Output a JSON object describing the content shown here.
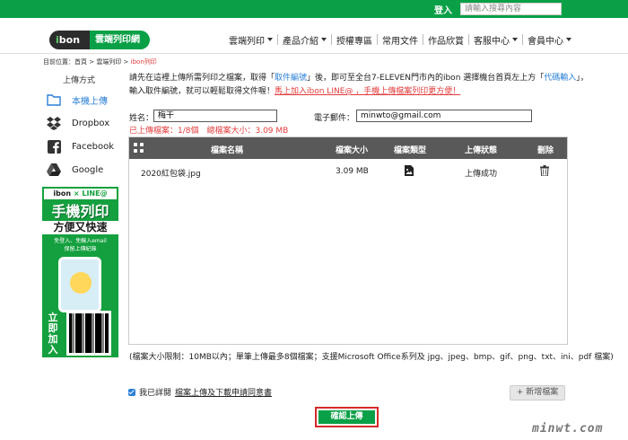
{
  "topbar": {
    "login": "登入",
    "search_placeholder": "請輸入搜尋內容"
  },
  "logo": {
    "brand_i": "i",
    "brand_rest": "bon",
    "tagline": "雲端列印網"
  },
  "nav": [
    {
      "label": "雲端列印",
      "dropdown": true
    },
    {
      "label": "產品介紹",
      "dropdown": true
    },
    {
      "label": "授權專區",
      "dropdown": false
    },
    {
      "label": "常用文件",
      "dropdown": false
    },
    {
      "label": "作品欣賞",
      "dropdown": false
    },
    {
      "label": "客服中心",
      "dropdown": true
    },
    {
      "label": "會員中心",
      "dropdown": true
    }
  ],
  "breadcrumb": {
    "prefix": "目前位置：",
    "home": "首頁",
    "sep": " > ",
    "section": "雲端列印",
    "current": "ibon列印"
  },
  "sidebar": {
    "title": "上傳方式",
    "items": [
      {
        "label": "本機上傳",
        "icon": "folder-icon"
      },
      {
        "label": "Dropbox",
        "icon": "dropbox-icon"
      },
      {
        "label": "Facebook",
        "icon": "facebook-icon"
      },
      {
        "label": "Google",
        "icon": "google-drive-icon"
      }
    ]
  },
  "promo": {
    "head_a": "ibon",
    "head_b": " × LINE@",
    "line1": "手機列印",
    "line2": "方便又快速",
    "sub1": "免登入、免輸入email",
    "sub2": "保留上傳紀錄",
    "cta": "立即加入"
  },
  "intro": {
    "p1": "請先在這裡上傳所需列印之檔案，取得「",
    "link1": "取件編號",
    "p2": "」後，即可至全台7-ELEVEN門市內的ibon 選擇機台首頁左上方「",
    "link2": "代碼輸入",
    "p3": "」，輸入取件編號，就可以輕鬆取得文件喔！",
    "red": "馬上加入ibon LINE@ ，手機上傳檔案列印更方便！"
  },
  "form": {
    "name_label": "姓名：",
    "name_value": "梅干",
    "email_label": "電子郵件：",
    "email_value": "minwto@gmail.com"
  },
  "counts": "已上傳檔案：1/8個　總檔案大小：3.09 MB",
  "table": {
    "headers": {
      "name": "檔案名稱",
      "size": "檔案大小",
      "type": "檔案類型",
      "status": "上傳狀態",
      "delete": "刪除"
    },
    "rows": [
      {
        "name": "2020紅包袋.jpg",
        "size": "3.09 MB",
        "type_icon": "image-file-icon",
        "status": "上傳成功",
        "delete_icon": "trash-icon"
      }
    ]
  },
  "limits": "(檔案大小限制：10MB以內；單筆上傳最多8個檔案；支援Microsoft Office系列及 jpg、jpeg、bmp、gif、png、txt、ini、pdf 檔案)",
  "agree": {
    "prefix": "我已詳閱",
    "link": "檔案上傳及下載申請同意書"
  },
  "buttons": {
    "add": "+ 新增檔案",
    "submit": "確認上傳"
  },
  "watermark": "minwt.com",
  "colors": {
    "brand_green": "#0aa047",
    "link_blue": "#2a7fd6",
    "alert_red": "#e23b3b",
    "table_header": "#595959"
  }
}
